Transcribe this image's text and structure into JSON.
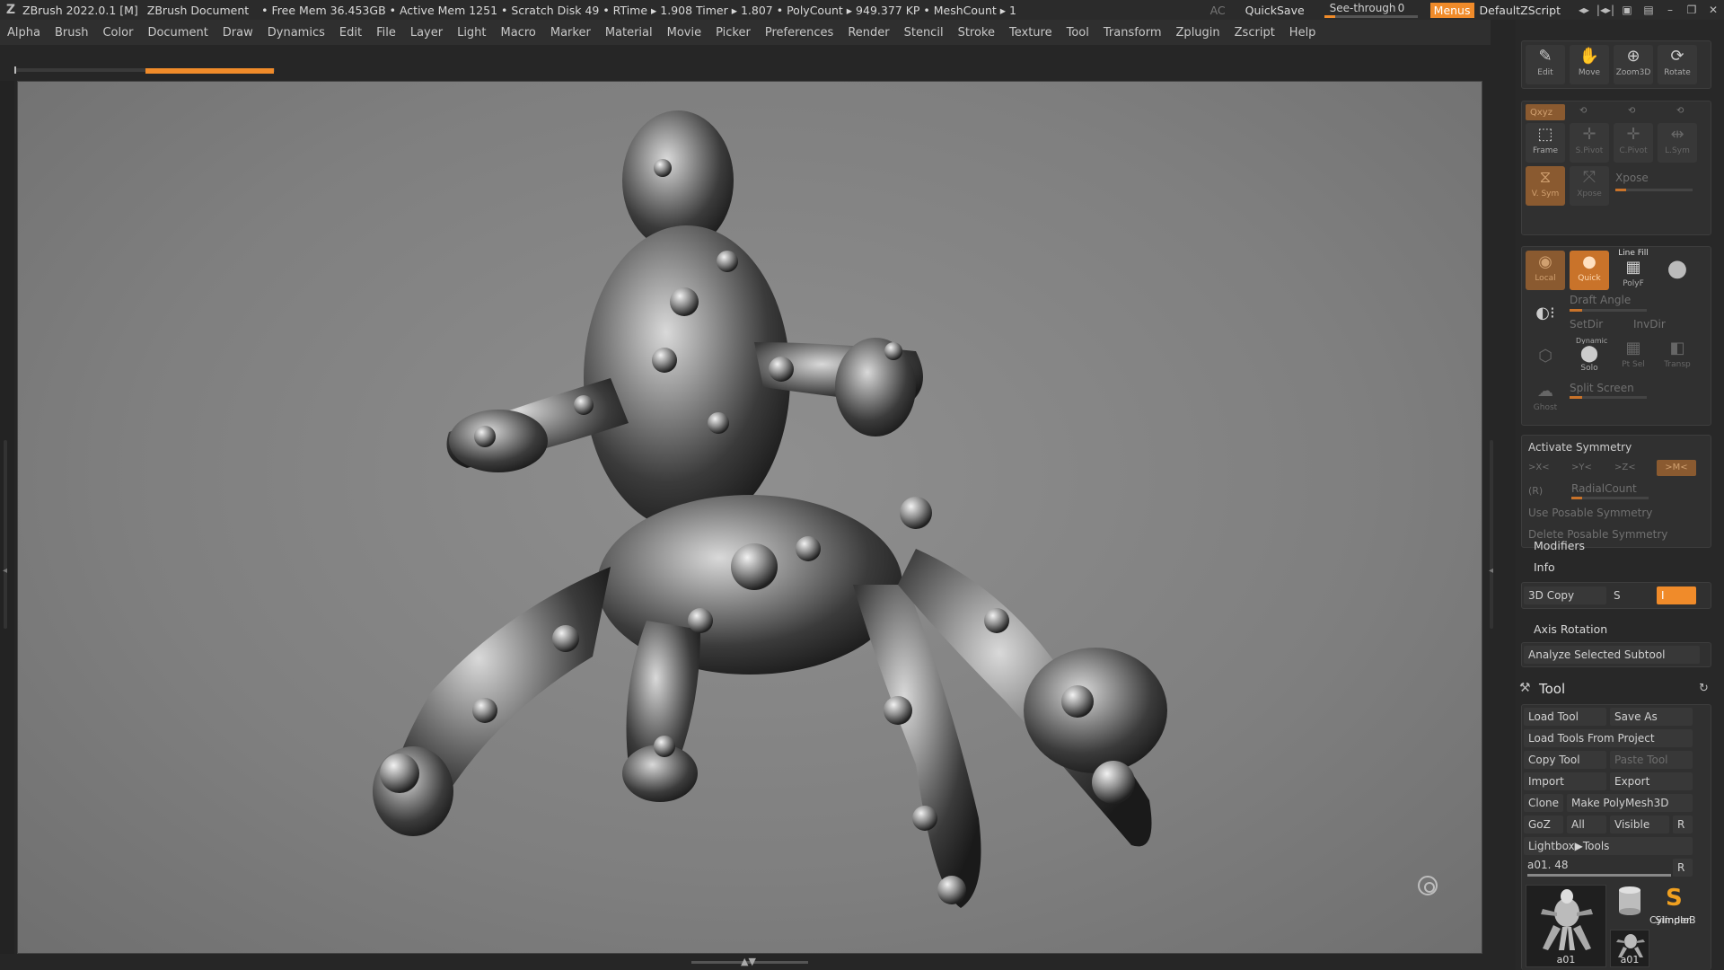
{
  "title_bar": {
    "app_title": "ZBrush 2022.0.1 [M]",
    "document": "ZBrush Document",
    "stats": "• Free Mem 36.453GB • Active Mem 1251 • Scratch Disk 49 • RTime ▸ 1.908 Timer ▸ 1.807 • PolyCount ▸ 949.377 KP • MeshCount ▸ 1",
    "ac_label": "AC",
    "quicksave_label": "QuickSave",
    "see_through_label": "See-through",
    "see_through_value": "0",
    "menus_label": "Menus",
    "script_label": "DefaultZScript"
  },
  "menu_bar": {
    "items": [
      "Alpha",
      "Brush",
      "Color",
      "Document",
      "Draw",
      "Dynamics",
      "Edit",
      "File",
      "Layer",
      "Light",
      "Macro",
      "Marker",
      "Material",
      "Movie",
      "Picker",
      "Preferences",
      "Render",
      "Stencil",
      "Stroke",
      "Texture",
      "Tool",
      "Transform",
      "Zplugin",
      "Zscript",
      "Help"
    ]
  },
  "nav_buttons": {
    "edit": "Edit",
    "move": "Move",
    "zoom3d": "Zoom3D",
    "rotate": "Rotate"
  },
  "transform_panel": {
    "xyz": "Qxyz",
    "frame": "Frame",
    "s_pivot": "S.Pivot",
    "c_pivot": "C.Pivot",
    "l_sym": "L.Sym",
    "v_sym": "V. Sym",
    "xpose_btn": "Xpose",
    "xpose_label": "Xpose",
    "local": "Local",
    "quick": "Quick",
    "line_fill": "Line Fill",
    "polyf": "PolyF",
    "draft_angle": "Draft Angle",
    "setdir": "SetDir",
    "invdir": "InvDir",
    "dynamic": "Dynamic",
    "solo": "Solo",
    "pt_sel": "Pt Sel",
    "transp": "Transp",
    "ghost": "Ghost",
    "split_screen": "Split Screen"
  },
  "symmetry": {
    "activate": "Activate Symmetry",
    "x": ">X<",
    "y": ">Y<",
    "z": ">Z<",
    "m": ">M<",
    "r": "(R)",
    "radial_count": "RadialCount",
    "use_posable": "Use Posable Symmetry",
    "delete_posable": "Delete Posable Symmetry"
  },
  "misc": {
    "modifiers": "Modifiers",
    "info": "Info",
    "copy3d": "3D Copy",
    "s_label": "S",
    "i_label": "I",
    "axis_rotation": "Axis Rotation",
    "analyze": "Analyze Selected Subtool"
  },
  "tool_palette": {
    "title": "Tool",
    "load_tool": "Load Tool",
    "save_as": "Save As",
    "load_from_project": "Load Tools From Project",
    "copy_tool": "Copy Tool",
    "paste_tool": "Paste Tool",
    "import": "Import",
    "export": "Export",
    "clone": "Clone",
    "make_polymesh": "Make PolyMesh3D",
    "goz": "GoZ",
    "all": "All",
    "visible": "Visible",
    "r": "R",
    "lightbox": "Lightbox▶Tools",
    "current_tool": "a01. 48",
    "r2": "R",
    "thumbs": [
      "a01",
      "Cylinder",
      "SimpleB",
      "a01"
    ]
  },
  "colors": {
    "accent": "#f08b2a",
    "panel_bg": "#282828",
    "viewport_bg": "#858585"
  }
}
